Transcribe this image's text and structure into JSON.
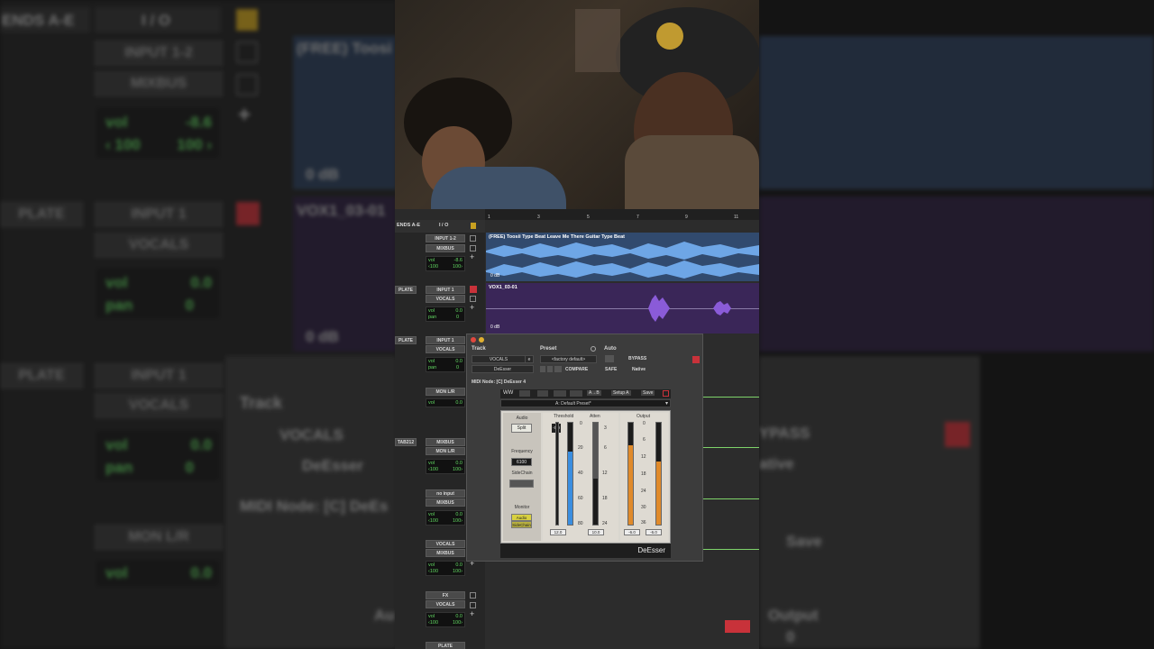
{
  "colors": {
    "accent_blue": "#6ea6e6",
    "accent_purple": "#8a5bd8",
    "meter_orange": "#e08a2a",
    "meter_blue": "#3a8ee0",
    "vol_green": "#61d861",
    "record_red": "#c8323a"
  },
  "background": {
    "header_left": "ENDS A-E",
    "header_io": "I / O",
    "input_12": "INPUT 1-2",
    "mixbus": "MIXBUS",
    "vol_label": "vol",
    "vol_value": "-8.6",
    "pan_left": "‹ 100",
    "pan_right": "100 ›",
    "clip_free": "(FREE) Toosi",
    "zero_db_1": "0 dB",
    "plate_1": "PLATE",
    "input_1": "INPUT 1",
    "vocals": "VOCALS",
    "vox_clip": "VOX1_03-01",
    "vol2_label": "vol",
    "vol2_value": "0.0",
    "pan2_label": "pan",
    "pan2_value": "0",
    "zero_db_2": "0 dB",
    "plate_2": "PLATE",
    "input_1b": "INPUT 1",
    "vocals_b": "VOCALS",
    "track_label": "Track",
    "vocals_c": "VOCALS",
    "deesser_c": "DeEsser",
    "vol3_label": "vol",
    "vol3_value": "0.0",
    "pan3_label": "pan",
    "pan3_value": "0",
    "midi_node": "MIDI Node: [C] DeEs",
    "mon_lr": "MON L/R",
    "vol4_label": "vol",
    "vol4_value": "0.0",
    "bypass_right": "YPASS",
    "native_right": "ative",
    "save_right": "Save",
    "output_right": "Output",
    "output_val_right": "0",
    "au_left": "Au"
  },
  "protools": {
    "header_sends": "ENDS A-E",
    "header_io": "I / O",
    "ruler": [
      "1",
      "3",
      "5",
      "7",
      "9",
      "11"
    ],
    "tracks": [
      {
        "send": "",
        "io_in": "INPUT 1-2",
        "io_out": "MIXBUS",
        "vol": "-8.6",
        "pan_l": "‹100",
        "pan_r": "100›"
      },
      {
        "send": "PLATE",
        "io_in": "INPUT 1",
        "io_out": "VOCALS",
        "vol": "0.0",
        "pan": "0"
      },
      {
        "send": "PLATE",
        "io_in": "INPUT 1",
        "io_out": "VOCALS",
        "vol": "0.0",
        "pan": "0"
      },
      {
        "send": "",
        "io_in": "MON L/R",
        "io_out": "",
        "vol": "0.0",
        "pan": ""
      },
      {
        "send": "TAB212",
        "io_in": "MIXBUS",
        "io_out": "MON L/R",
        "vol": "0.0",
        "pan_l": "‹100",
        "pan_r": "100›"
      },
      {
        "send": "",
        "io_in": "no input",
        "io_out": "MIXBUS",
        "vol": "0.0",
        "pan_l": "‹100",
        "pan_r": "100›"
      },
      {
        "send": "",
        "io_in": "VOCALS",
        "io_out": "MIXBUS",
        "vol": "0.0",
        "pan_l": "‹100",
        "pan_r": "100›"
      },
      {
        "send": "",
        "io_in": "FX",
        "io_out": "VOCALS",
        "vol": "0.0",
        "pan_l": "‹100",
        "pan_r": "100›"
      },
      {
        "send": "",
        "io_in": "PLATE",
        "io_out": "",
        "vol": "",
        "pan": ""
      }
    ],
    "clip_beat": "(FREE) Toosii Type Beat Leave Me There  Guitar Type Beat",
    "clip_vox": "VOX1_03-01",
    "zero_db": "0 dB",
    "plugin": {
      "track_label": "Track",
      "preset_label": "Preset",
      "auto_label": "Auto",
      "track_name": "VOCALS",
      "track_slot": "e",
      "preset_name": "<factory default>",
      "plugin_name": "DeEsser",
      "bypass": "BYPASS",
      "compare": "COMPARE",
      "safe": "SAFE",
      "native": "Native",
      "midi_node": "MIDI Node: [C] DeEsser 4",
      "ab_label": "A→B",
      "setup": "Setup A",
      "save": "Save",
      "preset_bar": "A: Default Preset*",
      "audio": "Audio",
      "split": "Split",
      "frequency": "Frequency",
      "freq_value": "6100",
      "sidechain": "SideChain",
      "monitor": "Monitor",
      "monitor_audio": "Audio",
      "monitor_sidechain": "SideChain",
      "threshold": "Threshold",
      "thresh_value": "-5.0",
      "atten": "Atten",
      "output": "Output",
      "thresh_scale": [
        "0",
        "20",
        "40",
        "60",
        "80"
      ],
      "atten_scale": [
        "3",
        "6",
        "12",
        "18",
        "24"
      ],
      "output_scale": [
        "0",
        "6",
        "12",
        "18",
        "24",
        "30",
        "36"
      ],
      "thresh_readout": "12.0",
      "atten_readout": "10.0",
      "out_readout_l": "-6.0",
      "out_readout_r": "-6.0",
      "brand": "DeEsser",
      "meter_levels": {
        "thresh_fill": 0.72,
        "atten_fill": 0.55,
        "out_l": 0.78,
        "out_r": 0.62
      }
    }
  }
}
